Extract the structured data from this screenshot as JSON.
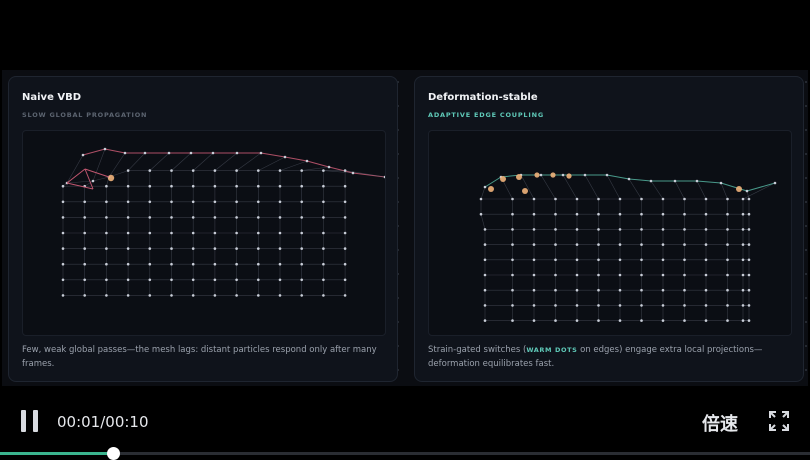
{
  "left_panel": {
    "title": "Naive VBD",
    "subtitle": "SLOW GLOBAL PROPAGATION",
    "caption": "Few, weak global passes—the mesh lags: distant particles respond only after many frames."
  },
  "right_panel": {
    "title": "Deformation-stable",
    "subtitle": "ADAPTIVE EDGE COUPLING",
    "caption_before": "Strain-gated switches (",
    "caption_highlight": "WARM DOTS",
    "caption_after": " on edges) engage extra local projections—deformation equilibrates fast."
  },
  "player": {
    "time": "00:01/00:10",
    "speed_label": "倍速",
    "progress": 0.14
  },
  "icons": [
    "pause-icon",
    "fullscreen-icon"
  ],
  "colors": {
    "left_edges": "#c0566f",
    "right_edges": "#4fa897",
    "nodes": "#c9ced8",
    "warm_dot": "#f0b27a",
    "progress": "#3bb58f"
  }
}
